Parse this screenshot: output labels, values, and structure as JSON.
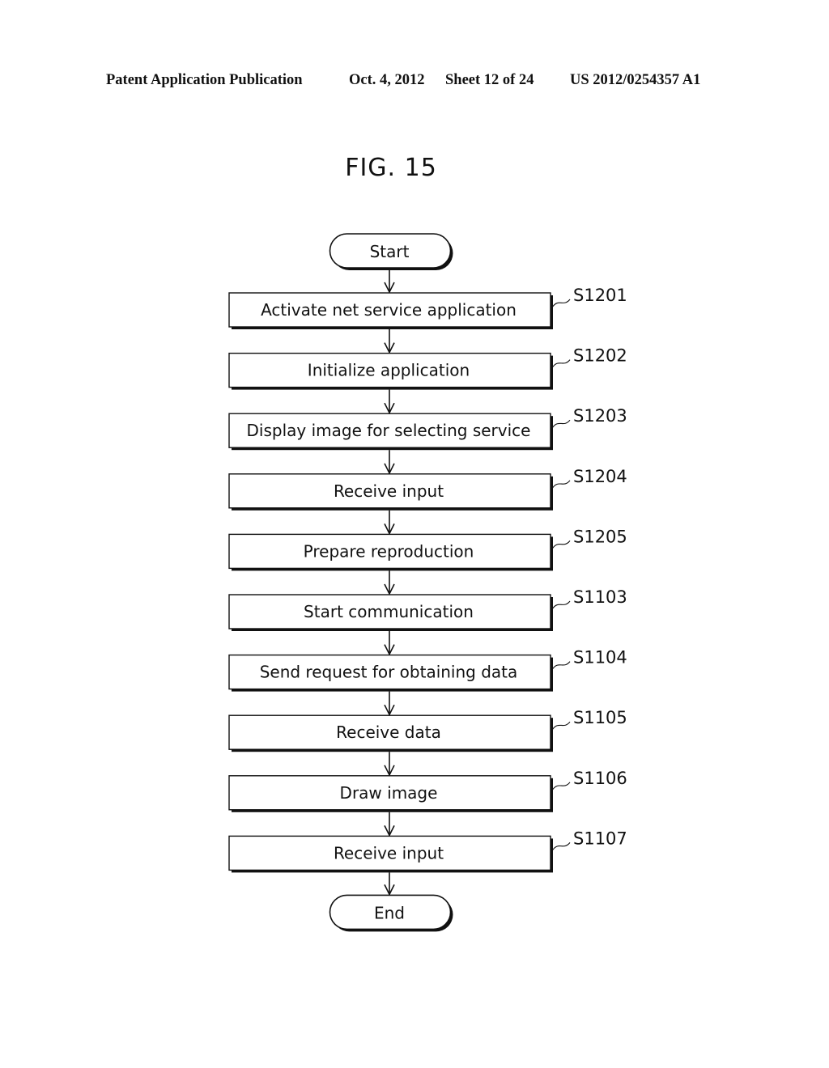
{
  "header": {
    "publication": "Patent Application Publication",
    "date": "Oct. 4, 2012",
    "sheet": "Sheet 12 of 24",
    "number": "US 2012/0254357 A1"
  },
  "figure": {
    "title": "FIG. 15"
  },
  "flowchart": {
    "start_label": "Start",
    "end_label": "End",
    "steps": [
      {
        "id": "S1201",
        "label": "Activate net service application"
      },
      {
        "id": "S1202",
        "label": "Initialize application"
      },
      {
        "id": "S1203",
        "label": "Display image for selecting service"
      },
      {
        "id": "S1204",
        "label": "Receive input"
      },
      {
        "id": "S1205",
        "label": "Prepare reproduction"
      },
      {
        "id": "S1103",
        "label": "Start communication"
      },
      {
        "id": "S1104",
        "label": "Send request for obtaining data"
      },
      {
        "id": "S1105",
        "label": "Receive data"
      },
      {
        "id": "S1106",
        "label": "Draw image"
      },
      {
        "id": "S1107",
        "label": "Receive input"
      }
    ]
  }
}
